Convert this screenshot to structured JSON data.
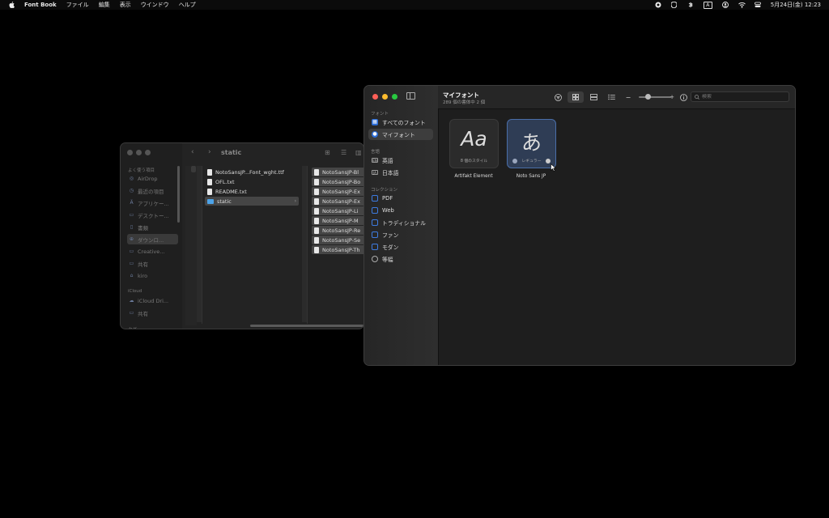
{
  "menubar": {
    "app_name": "Font Book",
    "menus": [
      "ファイル",
      "編集",
      "表示",
      "ウインドウ",
      "ヘルプ"
    ],
    "datetime": "5月24日(金)  12:23",
    "input_indicator": "A"
  },
  "finder": {
    "title": "static",
    "sidebar": {
      "favorites_label": "よく使う項目",
      "items": [
        "AirDrop",
        "最近の項目",
        "アプリケー...",
        "デスクトー...",
        "書類",
        "ダウンロ...",
        "Creative...",
        "共有",
        "kiro"
      ],
      "icloud_label": "iCloud",
      "icloud_items": [
        "iCloud Dri...",
        "共有"
      ],
      "locations_label": "タグ"
    },
    "column2": [
      "NotoSansJP...Font_wght.ttf",
      "OFL.txt",
      "README.txt",
      "static"
    ],
    "column3": [
      "NotoSansJP-Bl",
      "NotoSansJP-Bo",
      "NotoSansJP-Ex",
      "NotoSansJP-Ex",
      "NotoSansJP-Li",
      "NotoSansJP-M",
      "NotoSansJP-Re",
      "NotoSansJP-Se",
      "NotoSansJP-Th"
    ]
  },
  "fontbook": {
    "title": "マイフォント",
    "subtitle": "289 個の書体中 2 個",
    "search_placeholder": "検索",
    "sidebar": {
      "fonts_label": "フォント",
      "fonts": [
        "すべてのフォント",
        "マイフォント"
      ],
      "languages_label": "言語",
      "languages": [
        "英語",
        "日本語"
      ],
      "collections_label": "コレクション",
      "collections": [
        "PDF",
        "Web",
        "トラディショナル",
        "ファン",
        "モダン",
        "等幅"
      ]
    },
    "tiles": [
      {
        "glyph": "Aa",
        "styles": "8 個のスタイル",
        "name": "Artifakt Element"
      },
      {
        "glyph": "あ",
        "styles": "レギュラー",
        "name": "Noto Sans JP"
      }
    ],
    "colors": {
      "selection": "#3d3d3d",
      "accent": "#2b6cd6",
      "tile_selected": "#2f3d55"
    }
  }
}
